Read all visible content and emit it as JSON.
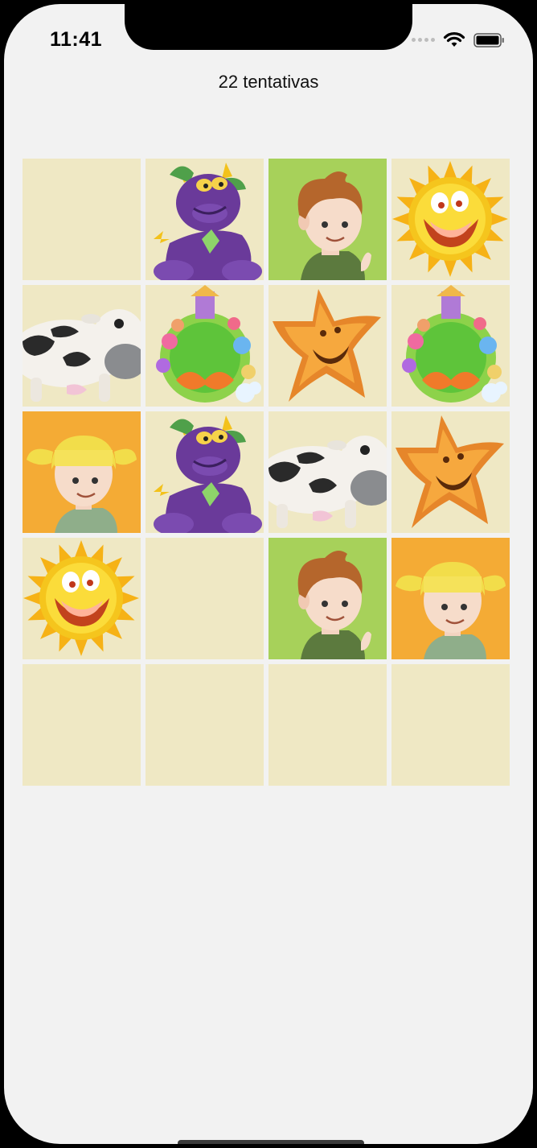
{
  "status_bar": {
    "time": "11:41"
  },
  "header": {
    "attempts_label": "22 tentativas"
  },
  "colors": {
    "card_back": "#efe8c4",
    "boy_bg": "#a7d15a",
    "girl_bg": "#f4ab35",
    "page_bg": "#f2f2f2"
  },
  "board": {
    "rows": [
      [
        "hidden",
        "dragon",
        "boy",
        "sun"
      ],
      [
        "cow",
        "planet",
        "starfish",
        "planet"
      ],
      [
        "girl",
        "dragon",
        "cow",
        "starfish"
      ],
      [
        "sun",
        "hidden",
        "boy",
        "girl"
      ],
      [
        "hidden",
        "hidden",
        "hidden",
        "hidden"
      ]
    ]
  }
}
